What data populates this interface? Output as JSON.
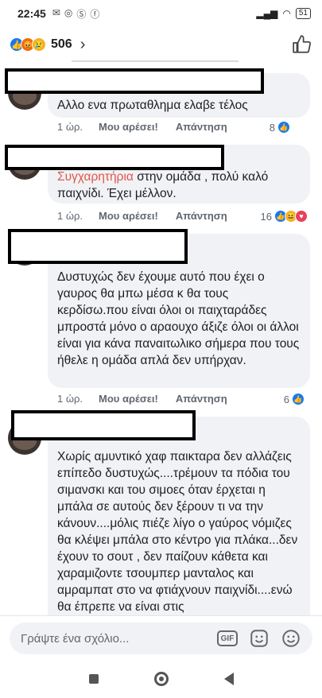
{
  "status_bar": {
    "time": "22:45",
    "battery": "51"
  },
  "reactions_header": {
    "count": "506"
  },
  "comments": [
    {
      "text": "Αλλο ενα πρωταθλημα ελαβε τέλος",
      "time": "1 ώρ.",
      "like_label": "Μου αρέσει!",
      "reply_label": "Απάντηση",
      "reaction_count": "8"
    },
    {
      "mention": "Συγχαρητήρια",
      "text": " στην ομάδα , πολύ καλό παιχνίδι. Έχει μέλλον.",
      "time": "1 ώρ.",
      "like_label": "Μου αρέσει!",
      "reply_label": "Απάντηση",
      "reaction_count": "16"
    },
    {
      "text": "Δυστυχώς δεν έχουμε αυτό που έχει ο γαυρος θα μπω μέσα κ θα τους κερδίσω.που είναι όλοι οι παιχταράδες μπροστά μόνο ο αραουχο άξιζε όλοι οι άλλοι είναι για κάνα παναιτωλικο σήμερα που τους ήθελε η ομάδα απλά δεν υπήρχαν.",
      "time": "1 ώρ.",
      "like_label": "Μου αρέσει!",
      "reply_label": "Απάντηση",
      "reaction_count": "6"
    },
    {
      "text": "Χωρίς αμυντικό χαφ παικταρα δεν αλλάζεις επίπεδο δυστυχώς....τρέμουν τα πόδια του σιμανσκι και του σιμοες όταν έρχεται η μπάλα σε αυτούς δεν ξέρουν τι να την κάνουν....μόλις πιέζε λίγο ο γαύρος νόμιζες θα κλέψει μπάλα στο κέντρο για πλάκα...δεν έχουν το σουτ , δεν παίζουν κάθετα και χαραμιζοντε τσουμπερ μανταλος και αμραμπατ στο να φτιάχνουν παιχνίδι....ενώ θα έπρεπε να είναι στις"
    }
  ],
  "composer": {
    "placeholder": "Γράψτε ένα σχόλιο..."
  },
  "icons": {
    "like": "thumbs-up-icon",
    "gif": "gif-icon",
    "sticker": "sticker-icon",
    "emoji": "emoji-icon"
  }
}
